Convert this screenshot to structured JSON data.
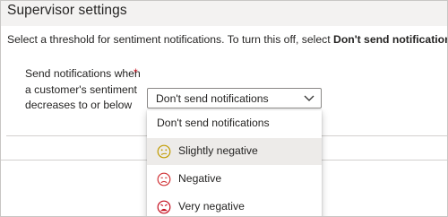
{
  "page": {
    "title": "Supervisor settings",
    "instruction_prefix": "Select a threshold for sentiment notifications. To turn this off, select ",
    "instruction_bold": "Don't send notifications."
  },
  "field": {
    "label": "Send notifications when a customer's sentiment decreases to or below",
    "required_marker": "*",
    "selected_value": "Don't send notifications"
  },
  "dropdown": {
    "options": [
      {
        "label": "Don't send notifications",
        "icon": "",
        "selected": false
      },
      {
        "label": "Slightly negative",
        "icon": "slightly-negative-face-icon",
        "icon_color": "#c19c00",
        "selected": true
      },
      {
        "label": "Negative",
        "icon": "negative-face-icon",
        "icon_color": "#d13438",
        "selected": false
      },
      {
        "label": "Very negative",
        "icon": "very-negative-face-icon",
        "icon_color": "#c50f1f",
        "selected": false
      }
    ]
  },
  "colors": {
    "title_band": "#f3f2f1",
    "required": "#c50f1f",
    "border": "#8a8886",
    "selected_option_bg": "#edebe9"
  }
}
